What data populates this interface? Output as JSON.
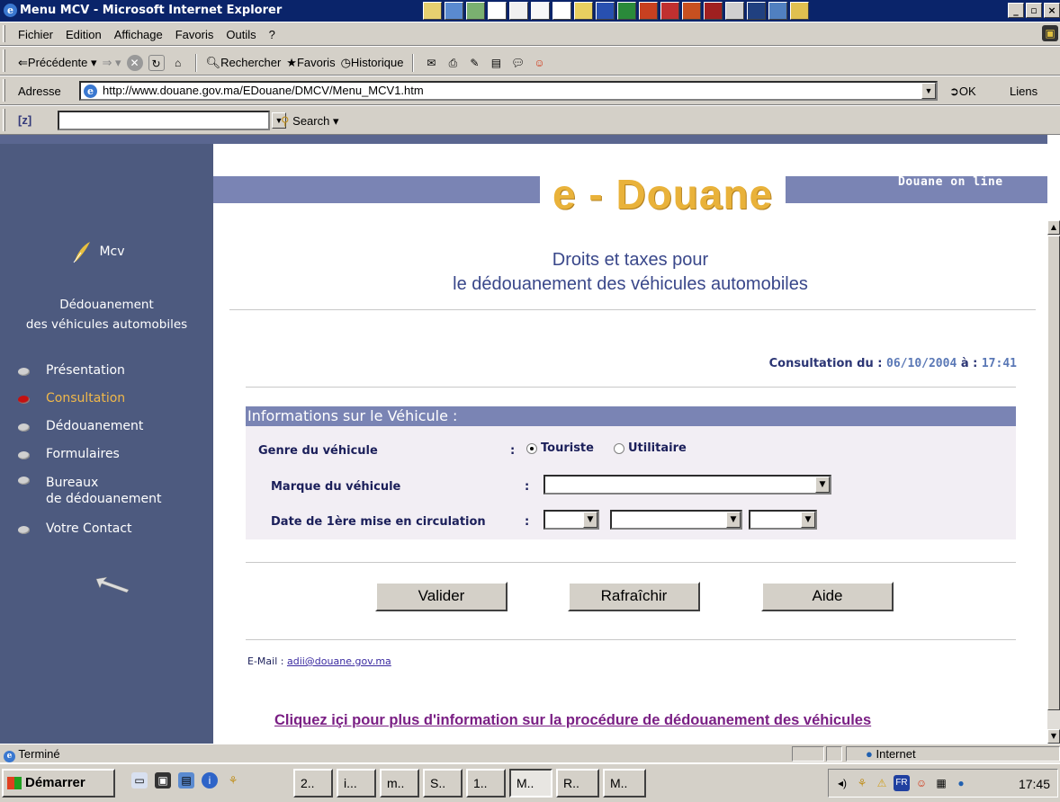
{
  "window": {
    "title": "Menu MCV - Microsoft Internet Explorer"
  },
  "menubar": {
    "items": [
      "Fichier",
      "Edition",
      "Affichage",
      "Favoris",
      "Outils",
      "?"
    ]
  },
  "toolbar": {
    "back": "Précédente",
    "search": "Rechercher",
    "favorites": "Favoris",
    "history": "Historique"
  },
  "address": {
    "label": "Adresse",
    "url": "http://www.douane.gov.ma/EDouane/DMCV/Menu_MCV1.htm",
    "go": "OK",
    "links": "Liens"
  },
  "zbar": {
    "label": "[z]",
    "search": "Search"
  },
  "site": {
    "online": "Douane on line",
    "logo": "e - Douane",
    "mcv": "Mcv",
    "subtitle_1": "Dédouanement",
    "subtitle_2": "des véhicules automobiles",
    "nav": [
      {
        "label": "Présentation"
      },
      {
        "label": "Consultation"
      },
      {
        "label": "Dédouanement"
      },
      {
        "label": "Formulaires"
      },
      {
        "label": "Bureaux de dédouanement"
      },
      {
        "label": "Votre Contact"
      }
    ],
    "nav_b1": "Bureaux",
    "nav_b2": "de dédouanement"
  },
  "content": {
    "heading_1": "Droits et taxes pour",
    "heading_2": "le dédouanement des véhicules automobiles",
    "consult_label": "Consultation du :",
    "consult_date": "06/10/2004",
    "consult_at": "à :",
    "consult_time": "17:41",
    "form_title": "Informations sur le Véhicule :",
    "genre_label": "Genre du véhicule",
    "genre_touriste": "Touriste",
    "genre_utilitaire": "Utilitaire",
    "marque_label": "Marque du véhicule",
    "date_label": "Date de 1ère mise en circulation",
    "colon": ":",
    "btn_valider": "Valider",
    "btn_refresh": "Rafraîchir",
    "btn_aide": "Aide",
    "email_label": "E-Mail :",
    "email": "adii@douane.gov.ma",
    "more_info": "Cliquez içi pour plus d'information sur la procédure de dédouanement des véhicules"
  },
  "status": {
    "text": "Terminé",
    "zone": "Internet"
  },
  "taskbar": {
    "start": "Démarrer",
    "tasks": [
      "2..",
      "i...",
      "m..",
      "S..",
      "1..",
      "M..",
      "R..",
      "M.."
    ],
    "clock": "17:45",
    "lang": "FR"
  },
  "colors": {
    "nav_bg": "#4d5a7f",
    "band": "#7a84b4",
    "logo": "#e9b23a",
    "heading": "#39478a",
    "active": "#f0b84a",
    "link": "#7a1f84"
  }
}
